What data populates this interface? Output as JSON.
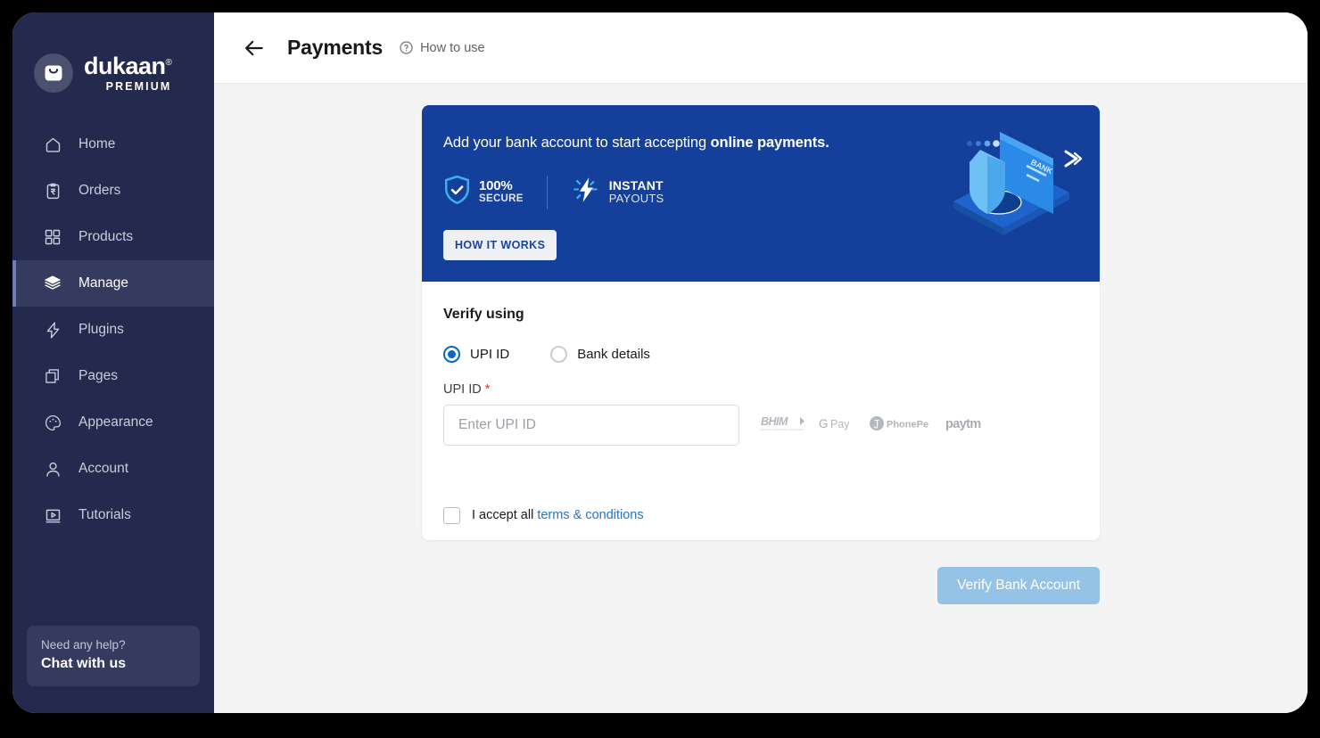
{
  "sidebar": {
    "brand": {
      "name": "dukaan",
      "reg": "®",
      "sub": "PREMIUM",
      "icon": "shopping-bag-icon"
    },
    "items": [
      {
        "label": "Home",
        "icon": "home-icon",
        "active": false
      },
      {
        "label": "Orders",
        "icon": "clipboard-rupee-icon",
        "active": false
      },
      {
        "label": "Products",
        "icon": "grid-icon",
        "active": false
      },
      {
        "label": "Manage",
        "icon": "layers-icon",
        "active": true
      },
      {
        "label": "Plugins",
        "icon": "bolt-icon",
        "active": false
      },
      {
        "label": "Pages",
        "icon": "copy-icon",
        "active": false
      },
      {
        "label": "Appearance",
        "icon": "palette-icon",
        "active": false
      },
      {
        "label": "Account",
        "icon": "user-icon",
        "active": false
      },
      {
        "label": "Tutorials",
        "icon": "video-player-icon",
        "active": false
      }
    ],
    "help": {
      "title": "Need any help?",
      "action": "Chat with us"
    }
  },
  "topbar": {
    "back_icon": "arrow-left-icon",
    "title": "Payments",
    "help_icon": "question-circle-icon",
    "help_label": "How to use"
  },
  "banner": {
    "text_plain": "Add your bank account to start accepting ",
    "text_bold": "online payments.",
    "badges": [
      {
        "icon": "shield-check-icon",
        "line1": "100%",
        "line2": "SECURE"
      },
      {
        "icon": "lightning-bolt-icon",
        "line1": "INSTANT",
        "line2": "PAYOUTS"
      }
    ],
    "button": "HOW IT WORKS",
    "illustration": "phone-card-shield-illustration",
    "bg_color": "#14409b"
  },
  "form": {
    "section_title": "Verify using",
    "options": [
      {
        "label": "UPI ID",
        "selected": true
      },
      {
        "label": "Bank details",
        "selected": false
      }
    ],
    "upi_label": "UPI ID",
    "required_mark": "*",
    "upi_value": "",
    "upi_placeholder": "Enter UPI ID",
    "payment_logos": [
      {
        "name": "bhim-logo",
        "text": "BHIM"
      },
      {
        "name": "gpay-logo",
        "text": "G Pay"
      },
      {
        "name": "phonepe-logo",
        "text": "PhonePe"
      },
      {
        "name": "paytm-logo",
        "text": "paytm"
      }
    ],
    "accept_text": "I accept all ",
    "accept_link": "terms & conditions",
    "accept_checked": false
  },
  "footer": {
    "submit_label": "Verify Bank Account"
  },
  "colors": {
    "sidebar_bg": "#232a4d",
    "sidebar_active": "#343b5e",
    "banner_blue": "#14409b",
    "accent_blue": "#0968c3",
    "link_blue": "#2575c9",
    "required_red": "#e8302f",
    "submit_disabled": "#94c3e5",
    "badge_cyan": "#3bb4e5"
  }
}
